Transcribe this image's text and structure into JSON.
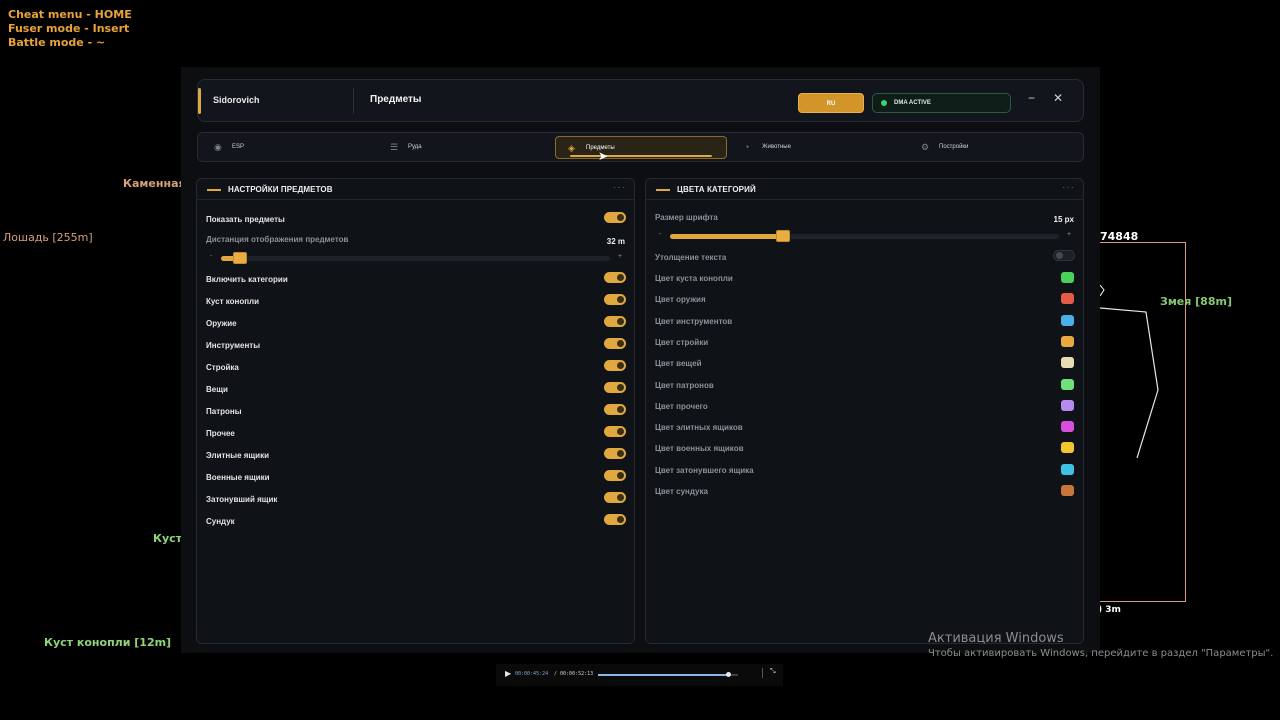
{
  "hints": [
    "Cheat menu - HOME",
    "Fuser mode - Insert",
    "Battle mode - ~"
  ],
  "overlay": {
    "stone": "Каменная р",
    "horse": "Лошадь [255m]",
    "snake": "Змея [88m]",
    "id_text": "74848",
    "dist_text": ") 3m",
    "bush_partial": "Куст к",
    "bush": "Куст конопли [12m]"
  },
  "window": {
    "brand": "Sidorovich",
    "title": "Предметы",
    "lang": "RU",
    "dma_status": "DMA ACTIVE",
    "minimize_glyph": "−",
    "close_glyph": "✕"
  },
  "tabs": [
    {
      "label": "ESP",
      "icon": "eye-icon"
    },
    {
      "label": "Руда",
      "icon": "sliders-icon"
    },
    {
      "label": "Предметы",
      "icon": "target-icon",
      "active": true
    },
    {
      "label": "Животные",
      "icon": "gauge-icon"
    },
    {
      "label": "Постройки",
      "icon": "gear-icon"
    }
  ],
  "left_panel": {
    "title": "НАСТРОЙКИ ПРЕДМЕТОВ",
    "show_items": {
      "label": "Показать предметы",
      "on": true
    },
    "distance": {
      "label": "Дистанция отображения предметов",
      "value": "32 m",
      "fraction": 0.05,
      "minus": "-",
      "plus": "+"
    },
    "toggles": [
      {
        "label": "Включить категории",
        "on": true
      },
      {
        "label": "Куст конопли",
        "on": true
      },
      {
        "label": "Оружие",
        "on": true
      },
      {
        "label": "Инструменты",
        "on": true
      },
      {
        "label": "Стройка",
        "on": true
      },
      {
        "label": "Вещи",
        "on": true
      },
      {
        "label": "Патроны",
        "on": true
      },
      {
        "label": "Прочее",
        "on": true
      },
      {
        "label": "Элитные ящики",
        "on": true
      },
      {
        "label": "Военные ящики",
        "on": true
      },
      {
        "label": "Затонувший ящик",
        "on": true
      },
      {
        "label": "Сундук",
        "on": true
      }
    ]
  },
  "right_panel": {
    "title": "ЦВЕТА КАТЕГОРИЙ",
    "font_size": {
      "label": "Размер шрифта",
      "value": "15 px",
      "fraction": 0.29,
      "minus": "-",
      "plus": "+"
    },
    "bold_text": {
      "label": "Утолщение текста",
      "on": false
    },
    "colors": [
      {
        "label": "Цвет куста конопли",
        "color": "#4bd15a"
      },
      {
        "label": "Цвет оружия",
        "color": "#e65a48"
      },
      {
        "label": "Цвет инструментов",
        "color": "#4aaee8"
      },
      {
        "label": "Цвет стройки",
        "color": "#e9a93f"
      },
      {
        "label": "Цвет вещей",
        "color": "#e7dcb4"
      },
      {
        "label": "Цвет патронов",
        "color": "#6fe07a"
      },
      {
        "label": "Цвет прочего",
        "color": "#b48bef"
      },
      {
        "label": "Цвет элитных ящиков",
        "color": "#d84fe0"
      },
      {
        "label": "Цвет военных ящиков",
        "color": "#f2c531"
      },
      {
        "label": "Цвет затонувшего ящика",
        "color": "#3fc1e6"
      },
      {
        "label": "Цвет сундука",
        "color": "#c8763a"
      }
    ]
  },
  "media": {
    "current": "00:00:45:24",
    "separator": "/",
    "total": "00:00:52:13",
    "progress": 0.93
  },
  "activation": {
    "title": "Активация Windows",
    "subtitle": "Чтобы активировать Windows, перейдите в раздел \"Параметры\"."
  }
}
